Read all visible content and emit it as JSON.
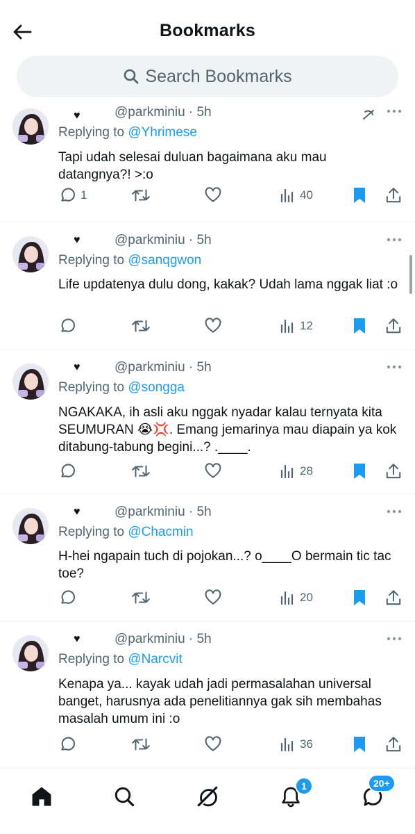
{
  "header": {
    "title": "Bookmarks",
    "search_placeholder": "Search Bookmarks"
  },
  "tweets": [
    {
      "heart": "♥",
      "handle_time": "@parkminiu · 5h",
      "replying_prefix": "Replying to",
      "replying_to": "@Yhrimese",
      "text": "Tapi udah selesai duluan bagaimana aku mau datangnya?! >:o",
      "replies": "1",
      "views": "40",
      "bookmarked": true
    },
    {
      "heart": "♥",
      "handle_time": "@parkminiu · 5h",
      "replying_prefix": "Replying to",
      "replying_to": "@sanqgwon",
      "text": "Life updatenya dulu dong, kakak? Udah lama nggak liat :o",
      "replies": "",
      "views": "12",
      "bookmarked": true
    },
    {
      "heart": "♥",
      "handle_time": "@parkminiu · 5h",
      "replying_prefix": "Replying to",
      "replying_to": "@songga",
      "text": "NGAKAKA, ih asli aku nggak nyadar kalau ternyata kita SEUMURAN 😭💢. Emang jemarinya mau diapain ya kok ditabung-tabung begini...? .____.",
      "replies": "",
      "views": "28",
      "bookmarked": true
    },
    {
      "heart": "♥",
      "handle_time": "@parkminiu · 5h",
      "replying_prefix": "Replying to",
      "replying_to": "@Chacmin",
      "text": "H-hei ngapain tuch di pojokan...? o____O bermain tic tac toe?",
      "replies": "",
      "views": "20",
      "bookmarked": true
    },
    {
      "heart": "♥",
      "handle_time": "@parkminiu · 5h",
      "replying_prefix": "Replying to",
      "replying_to": "@Narcvit",
      "text": "Kenapa ya... kayak udah jadi permasalahan universal banget, harusnya ada penelitiannya gak sih membahas masalah umum ini :o",
      "replies": "",
      "views": "36",
      "bookmarked": true
    }
  ],
  "nav": {
    "notifications_badge": "1",
    "messages_badge": "20+"
  },
  "icons": {
    "back": "arrow-left-icon",
    "search": "search-icon",
    "reply": "reply-icon",
    "retweet": "retweet-icon",
    "like": "heart-icon",
    "views": "views-icon",
    "bookmark": "bookmark-icon",
    "share": "share-icon",
    "more": "more-icon",
    "home": "home-icon",
    "explore": "search-icon",
    "grok": "grok-icon",
    "notifications": "bell-icon",
    "messages": "messages-icon"
  },
  "colors": {
    "accent": "#1d9bf0",
    "text": "#0f1419",
    "muted": "#536471",
    "search_bg": "#eff3f4"
  }
}
